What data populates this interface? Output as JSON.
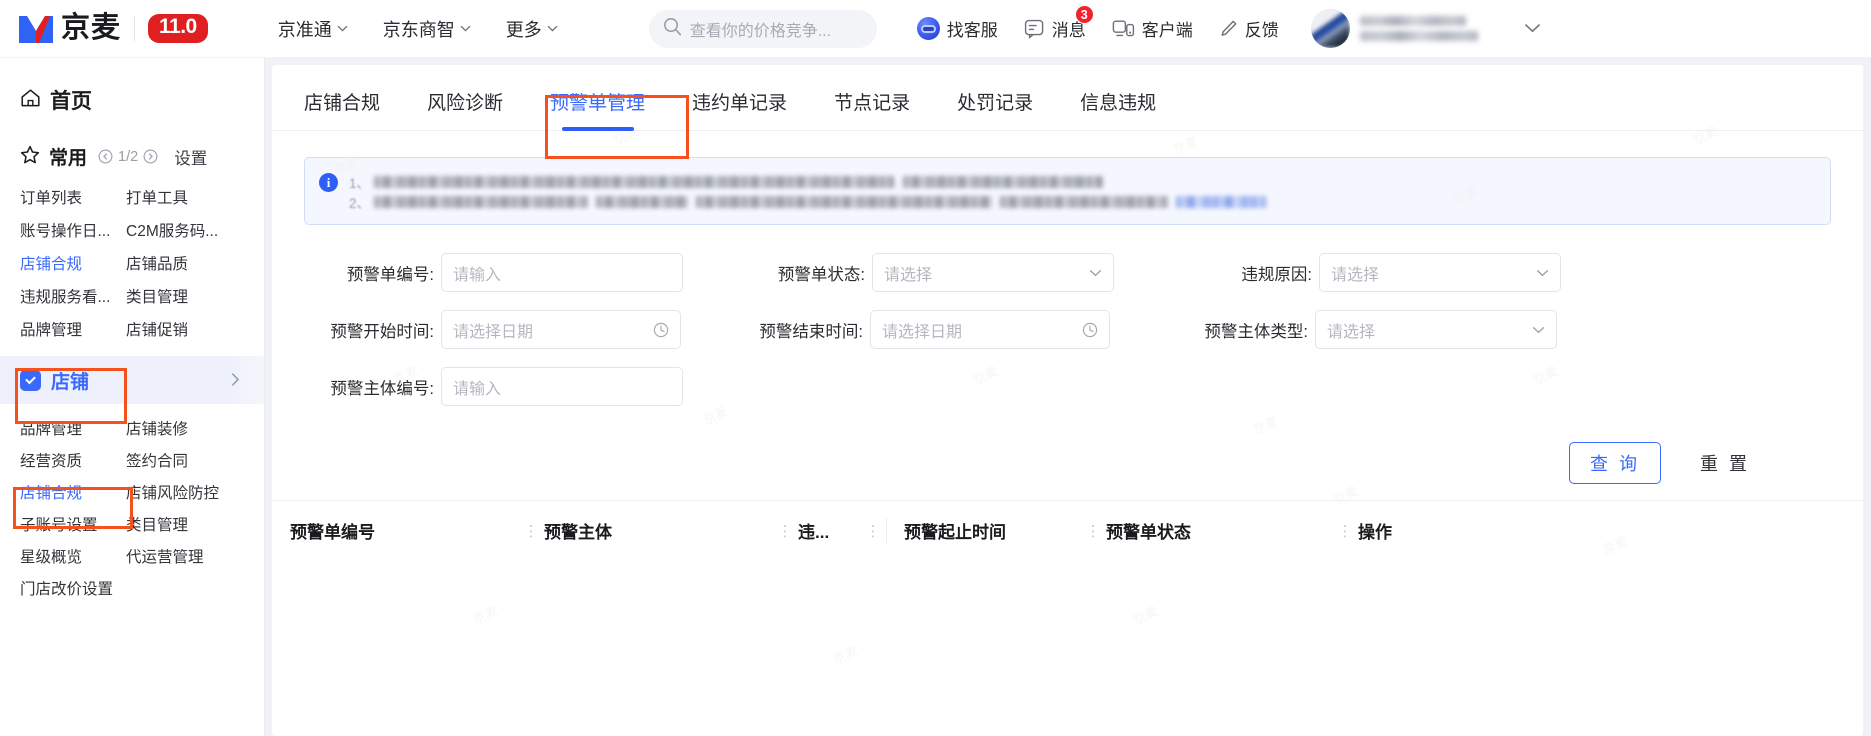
{
  "header": {
    "logo_text": "京麦",
    "version_badge": "11.0",
    "nav": [
      {
        "label": "京准通",
        "icon": "chevron-down-icon"
      },
      {
        "label": "京东商智",
        "icon": "chevron-down-icon"
      },
      {
        "label": "更多",
        "icon": "chevron-down-icon"
      }
    ],
    "search": {
      "placeholder": "查看你的价格竞争...",
      "icon": "search-icon"
    },
    "actions": [
      {
        "label": "找客服",
        "icon": "customer-service-avatar-icon",
        "badge": ""
      },
      {
        "label": "消息",
        "icon": "message-icon",
        "badge": "3"
      },
      {
        "label": "客户端",
        "icon": "desktop-client-icon",
        "badge": ""
      },
      {
        "label": "反馈",
        "icon": "pencil-feedback-icon",
        "badge": ""
      }
    ],
    "user": {
      "name_redacted": true,
      "caret": "chevron-down-icon"
    }
  },
  "sidebar": {
    "home": {
      "label": "首页",
      "icon": "home-icon"
    },
    "favorites": {
      "label": "常用",
      "icon": "star-icon",
      "page_indicator": "1/2",
      "prev_icon": "chevron-left-circle-icon",
      "next_icon": "chevron-right-circle-icon",
      "settings_label": "设置"
    },
    "favorite_links": [
      {
        "label": "订单列表",
        "active": false
      },
      {
        "label": "打单工具",
        "active": false
      },
      {
        "label": "账号操作日...",
        "active": false
      },
      {
        "label": "C2M服务码...",
        "active": false
      },
      {
        "label": "店铺合规",
        "active": true
      },
      {
        "label": "店铺品质",
        "active": false
      },
      {
        "label": "违规服务看...",
        "active": false
      },
      {
        "label": "类目管理",
        "active": false
      },
      {
        "label": "品牌管理",
        "active": false
      },
      {
        "label": "店铺促销",
        "active": false
      }
    ],
    "group": {
      "label": "店铺",
      "icon": "shop-icon",
      "expand_icon": "chevron-right-icon",
      "annotated": true
    },
    "group_links": [
      {
        "label": "品牌管理",
        "active": false
      },
      {
        "label": "店铺装修",
        "active": false
      },
      {
        "label": "经营资质",
        "active": false
      },
      {
        "label": "签约合同",
        "active": false
      },
      {
        "label": "店铺合规",
        "active": true,
        "annotated": true
      },
      {
        "label": "店铺风险防控",
        "active": false
      },
      {
        "label": "子账号设置",
        "active": false
      },
      {
        "label": "类目管理",
        "active": false
      },
      {
        "label": "星级概览",
        "active": false
      },
      {
        "label": "代运营管理",
        "active": false
      },
      {
        "label": "门店改价设置",
        "active": false
      }
    ]
  },
  "main": {
    "tabs": [
      {
        "label": "店铺合规",
        "active": false
      },
      {
        "label": "风险诊断",
        "active": false
      },
      {
        "label": "预警单管理",
        "active": true,
        "annotated": true
      },
      {
        "label": "违约单记录",
        "active": false
      },
      {
        "label": "节点记录",
        "active": false
      },
      {
        "label": "处罚记录",
        "active": false
      },
      {
        "label": "信息违规",
        "active": false
      }
    ],
    "notice": {
      "icon": "info-circle-icon",
      "lines": [
        {
          "number": "1、",
          "redacted": true
        },
        {
          "number": "2、",
          "redacted": true
        }
      ]
    },
    "filters": [
      [
        {
          "label": "预警单编号:",
          "type": "input",
          "placeholder": "请输入",
          "value": ""
        },
        {
          "label": "预警单状态:",
          "type": "select",
          "placeholder": "请选择",
          "value": "",
          "suffix": "chevron-down-icon"
        },
        {
          "label": "违规原因:",
          "type": "select",
          "placeholder": "请选择",
          "value": "",
          "suffix": "chevron-down-icon"
        }
      ],
      [
        {
          "label": "预警开始时间:",
          "type": "date",
          "placeholder": "请选择日期",
          "value": "",
          "suffix": "clock-icon"
        },
        {
          "label": "预警结束时间:",
          "type": "date",
          "placeholder": "请选择日期",
          "value": "",
          "suffix": "clock-icon"
        },
        {
          "label": "预警主体类型:",
          "type": "select",
          "placeholder": "请选择",
          "value": "",
          "suffix": "chevron-down-icon"
        }
      ],
      [
        {
          "label": "预警主体编号:",
          "type": "input",
          "placeholder": "请输入",
          "value": ""
        }
      ]
    ],
    "buttons": {
      "query": "查 询",
      "reset": "重 置"
    },
    "table": {
      "columns": [
        {
          "label": "预警单编号",
          "resizable": true
        },
        {
          "label": "预警主体",
          "resizable": true
        },
        {
          "label": "违...",
          "resizable": true
        },
        {
          "label": "预警起止时间",
          "resizable": true
        },
        {
          "label": "预警单状态",
          "resizable": true
        },
        {
          "label": "操作",
          "resizable": false
        }
      ],
      "rows": []
    }
  },
  "colors": {
    "brand_blue": "#3a6afd",
    "badge_red": "#e02020",
    "annotation_orange": "#f4511e",
    "notice_bg": "#f4f7fe",
    "page_bg": "#f0f2f7"
  },
  "watermark_text": "京麦"
}
